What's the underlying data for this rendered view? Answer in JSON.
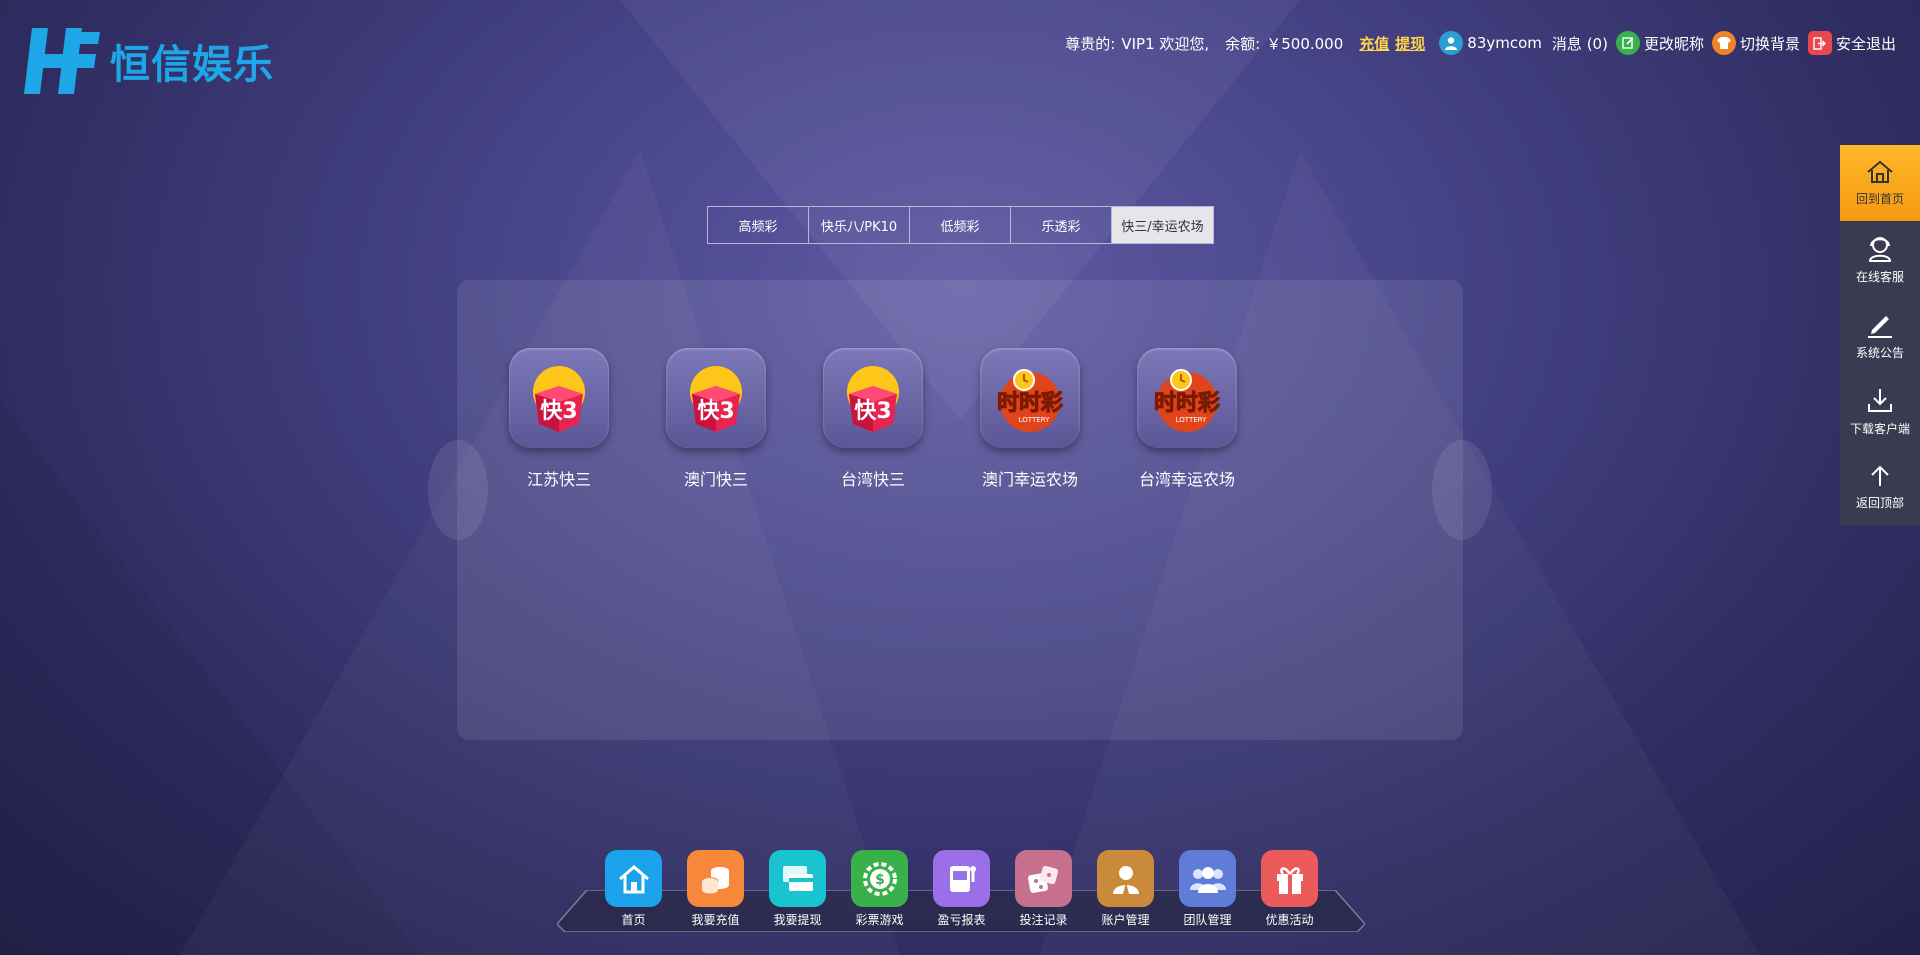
{
  "brand": {
    "name": "恒信娱乐",
    "accent": "#1ea7e8"
  },
  "topbar": {
    "greeting": "尊贵的:",
    "vip": "VIP1 欢迎您,",
    "balance_label": "余额:",
    "balance": "￥500.000",
    "recharge": "充值",
    "withdraw": "提现",
    "username": "83ymcom",
    "messages": "消息 (0)",
    "edit_nickname": "更改昵称",
    "switch_bg": "切换背景",
    "logout": "安全退出"
  },
  "tabs": [
    {
      "label": "高频彩",
      "active": false
    },
    {
      "label": "快乐八/PK10",
      "active": false
    },
    {
      "label": "低频彩",
      "active": false
    },
    {
      "label": "乐透彩",
      "active": false
    },
    {
      "label": "快三/幸运农场",
      "active": true
    }
  ],
  "games": [
    {
      "name": "江苏快三",
      "icon": "kuai3-dice-icon"
    },
    {
      "name": "澳门快三",
      "icon": "kuai3-dice-icon"
    },
    {
      "name": "台湾快三",
      "icon": "kuai3-dice-icon"
    },
    {
      "name": "澳门幸运农场",
      "icon": "shishicai-lottery-icon"
    },
    {
      "name": "台湾幸运农场",
      "icon": "shishicai-lottery-icon"
    }
  ],
  "sidebar": [
    {
      "label": "回到首页",
      "icon": "home-icon"
    },
    {
      "label": "在线客服",
      "icon": "support-agent-icon"
    },
    {
      "label": "系统公告",
      "icon": "pencil-icon"
    },
    {
      "label": "下载客户端",
      "icon": "download-icon"
    },
    {
      "label": "返回顶部",
      "icon": "arrow-up-icon"
    }
  ],
  "dock": [
    {
      "label": "首页",
      "icon": "home-icon",
      "color": "#1aa3ea"
    },
    {
      "label": "我要充值",
      "icon": "coins-icon",
      "color": "#f7883b"
    },
    {
      "label": "我要提现",
      "icon": "card-icon",
      "color": "#19c3cf"
    },
    {
      "label": "彩票游戏",
      "icon": "dollar-chip-icon",
      "color": "#3ab04a"
    },
    {
      "label": "盈亏报表",
      "icon": "slot-machine-icon",
      "color": "#9a6fe8"
    },
    {
      "label": "投注记录",
      "icon": "dice-icon",
      "color": "#c7708d"
    },
    {
      "label": "账户管理",
      "icon": "user-badge-icon",
      "color": "#c98a3c"
    },
    {
      "label": "团队管理",
      "icon": "team-icon",
      "color": "#5f7cd9"
    },
    {
      "label": "优惠活动",
      "icon": "gift-icon",
      "color": "#ec5b5b"
    }
  ],
  "game_icon_text": {
    "kuai3": "快3",
    "ssc": "时时彩",
    "ssc_sub": "LOTTERY"
  }
}
